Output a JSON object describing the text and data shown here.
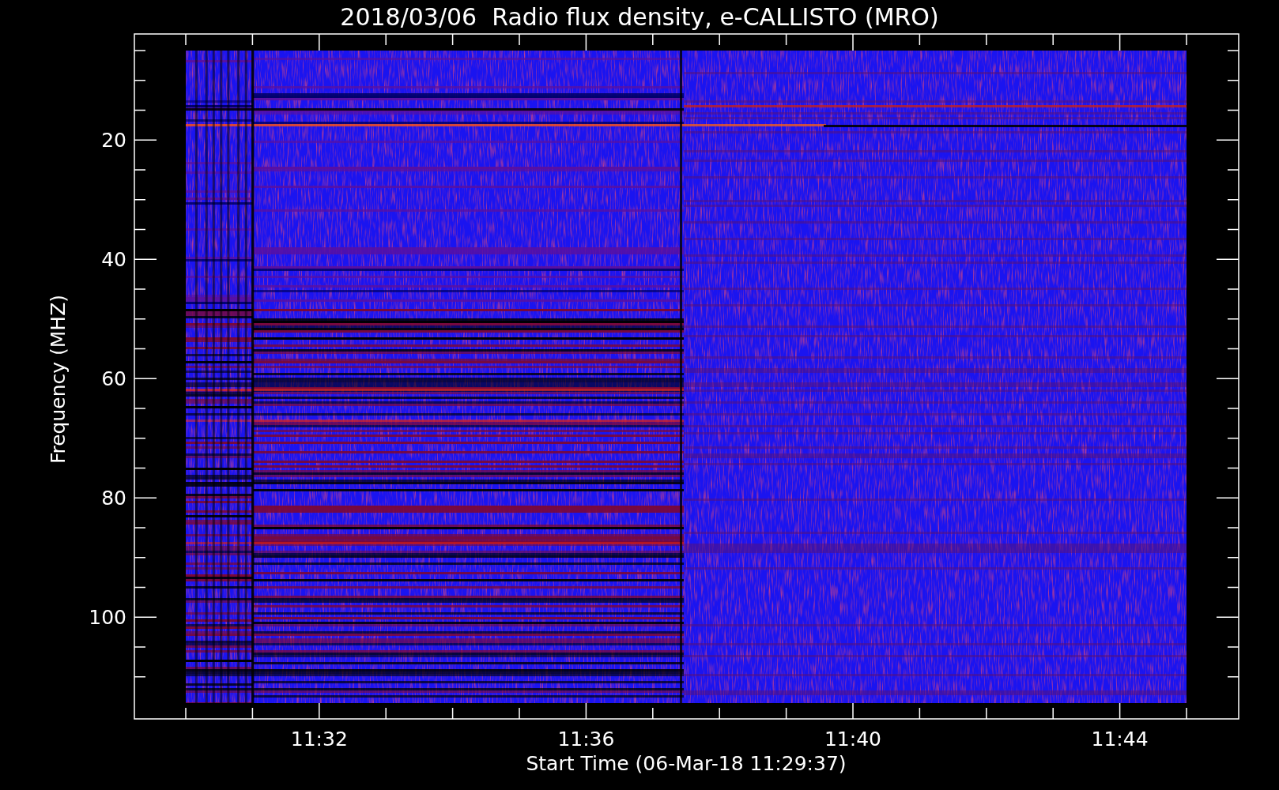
{
  "plot": {
    "title": "2018/03/06  Radio flux density, e-CALLISTO (MRO)",
    "y_axis": {
      "label": "Frequency (MHZ)",
      "tick_labels": [
        "20",
        "40",
        "60",
        "80",
        "100"
      ]
    },
    "x_axis": {
      "label": "Start Time (06-Mar-18 11:29:37)",
      "tick_labels": [
        "11:32",
        "11:36",
        "11:40",
        "11:44"
      ]
    }
  }
}
